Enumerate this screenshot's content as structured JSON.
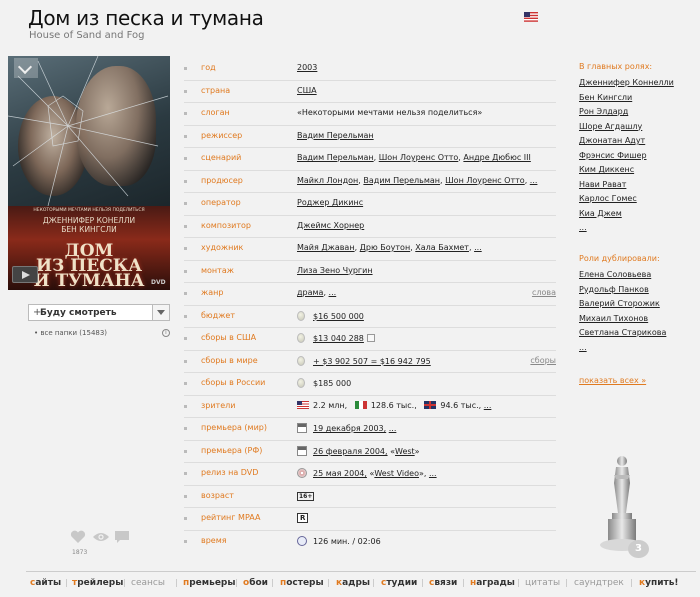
{
  "header": {
    "title": "Дом из песка и тумана",
    "original_title": "House of Sand and Fog"
  },
  "poster": {
    "cast_line1": "ДЖЕННИФЕР КОНЕЛЛИ",
    "cast_line2": "БЕН КИНГСЛИ",
    "tagline": "НЕКОТОРЫМИ МЕЧТАМИ НЕЛЬЗЯ ПОДЕЛИТЬСЯ",
    "title_line1": "ДОМ",
    "title_line2": "ИЗ ПЕСКА",
    "title_line3": "И ТУМАНА",
    "dvd_label": "DVD"
  },
  "watch": {
    "plus": "+",
    "label": "Буду смотреть",
    "folders": "• все папки (15483)",
    "info": "i"
  },
  "stats": {
    "count": "1873"
  },
  "info": {
    "year_label": "год",
    "year": "2003",
    "country_label": "страна",
    "country": "США",
    "slogan_label": "слоган",
    "slogan": "«Некоторыми мечтами нельзя поделиться»",
    "director_label": "режиссер",
    "director": "Вадим Перельман",
    "writers_label": "сценарий",
    "writers": [
      "Вадим Перельман",
      "Шон Лоуренс Отто",
      "Андре Дюбюс III"
    ],
    "producers_label": "продюсер",
    "producers": [
      "Майкл Лондон",
      "Вадим Перельман",
      "Шон Лоуренс Отто"
    ],
    "operator_label": "оператор",
    "operator": "Роджер Дикинс",
    "composer_label": "композитор",
    "composer": "Джеймс Хорнер",
    "artists_label": "художник",
    "artists": [
      "Майя Джаван",
      "Дрю Боутон",
      "Хала Бахмет"
    ],
    "editor_label": "монтаж",
    "editor": "Лиза Зено Чургин",
    "genre_label": "жанр",
    "genre": "драма",
    "words": "слова",
    "budget_label": "бюджет",
    "budget": "$16 500 000",
    "usa_gross_label": "сборы в США",
    "usa_gross": "$13 040 288",
    "world_gross_label": "сборы в мире",
    "world_gross": "+ $3 902 507 = $16 942 795",
    "gross_link": "сборы",
    "russia_gross_label": "сборы в России",
    "russia_gross": "$185 000",
    "viewers_label": "зрители",
    "viewers_us": "2.2 млн,",
    "viewers_it": "128.6 тыс.,",
    "viewers_uk": "94.6 тыс.,",
    "premiere_world_label": "премьера (мир)",
    "premiere_world": "19 декабря 2003,",
    "premiere_rf_label": "премьера (РФ)",
    "premiere_rf": "26 февраля 2004,",
    "premiere_rf_dist": "West",
    "dvd_label": "релиз на DVD",
    "dvd": "25 мая 2004,",
    "dvd_dist": "West Video",
    "age_label": "возраст",
    "age": "16+",
    "mpaa_label": "рейтинг MPAA",
    "mpaa": "R",
    "time_label": "время",
    "time": "126 мин. / 02:06",
    "ellipsis": "..."
  },
  "cast": {
    "header": "В главных ролях:",
    "items": [
      "Дженнифер Коннелли",
      "Бен Кингсли",
      "Рон Элдард",
      "Шоре Агдашлу",
      "Джонатан Адут",
      "Фрэнсис Фишер",
      "Ким Диккенс",
      "Нави Рават",
      "Карлос Гомес",
      "Киа Джем",
      "..."
    ]
  },
  "dubbing": {
    "header": "Роли дублировали:",
    "items": [
      "Елена Соловьева",
      "Рудольф Панков",
      "Валерий Сторожик",
      "Михаил Тихонов",
      "Светлана Старикова",
      "..."
    ],
    "show_all": "показать всех »"
  },
  "oscar": {
    "count": "3"
  },
  "bottom_nav": [
    {
      "first": "с",
      "rest": "айты",
      "dim": false
    },
    {
      "first": "т",
      "rest": "рейлеры",
      "dim": false
    },
    {
      "first": "",
      "rest": "сеансы",
      "dim": true
    },
    {
      "first": "п",
      "rest": "ремьеры",
      "dim": false
    },
    {
      "first": "о",
      "rest": "бои",
      "dim": false
    },
    {
      "first": "п",
      "rest": "остеры",
      "dim": false
    },
    {
      "first": "к",
      "rest": "адры",
      "dim": false
    },
    {
      "first": "с",
      "rest": "тудии",
      "dim": false
    },
    {
      "first": "с",
      "rest": "вязи",
      "dim": false
    },
    {
      "first": "н",
      "rest": "аграды",
      "dim": false
    },
    {
      "first": "",
      "rest": "цитаты",
      "dim": true
    },
    {
      "first": "",
      "rest": "саундтрек",
      "dim": true
    },
    {
      "first": "к",
      "rest": "упить!",
      "dim": false
    }
  ],
  "colors": {
    "accent": "#e07a20",
    "background": "#f2f2f2"
  }
}
